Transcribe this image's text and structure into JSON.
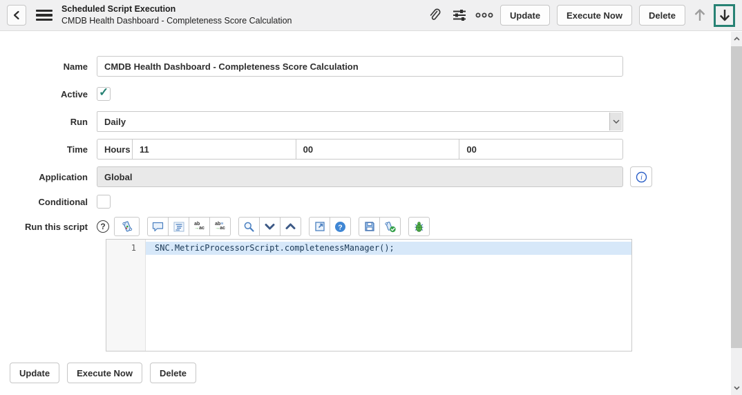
{
  "header": {
    "title": "Scheduled Script Execution",
    "subtitle": "CMDB Health Dashboard - Completeness Score Calculation",
    "buttons": {
      "update": "Update",
      "execute_now": "Execute Now",
      "delete": "Delete"
    }
  },
  "form": {
    "name": {
      "label": "Name",
      "value": "CMDB Health Dashboard - Completeness Score Calculation"
    },
    "active": {
      "label": "Active",
      "checked": true
    },
    "run": {
      "label": "Run",
      "value": "Daily"
    },
    "time": {
      "label": "Time",
      "unit": "Hours",
      "hours": "11",
      "minutes": "00",
      "seconds": "00"
    },
    "application": {
      "label": "Application",
      "value": "Global"
    },
    "conditional": {
      "label": "Conditional",
      "checked": false
    },
    "script": {
      "label": "Run this script",
      "line_number": "1",
      "code": "SNC.MetricProcessorScript.completenessManager();"
    }
  },
  "footer": {
    "update": "Update",
    "execute_now": "Execute Now",
    "delete": "Delete"
  },
  "icons": {
    "help_glyph": "?",
    "replace_top": "ab",
    "replace_arrow": "→",
    "replace_bottom": "ac",
    "lines_glyph": "≡"
  },
  "colors": {
    "accent_teal": "#278274",
    "editor_icon_blue": "#4a7fc0",
    "active_line_highlight": "#d7e8f9",
    "code_text": "#1c3a57",
    "header_background": "#f0f0f1"
  }
}
